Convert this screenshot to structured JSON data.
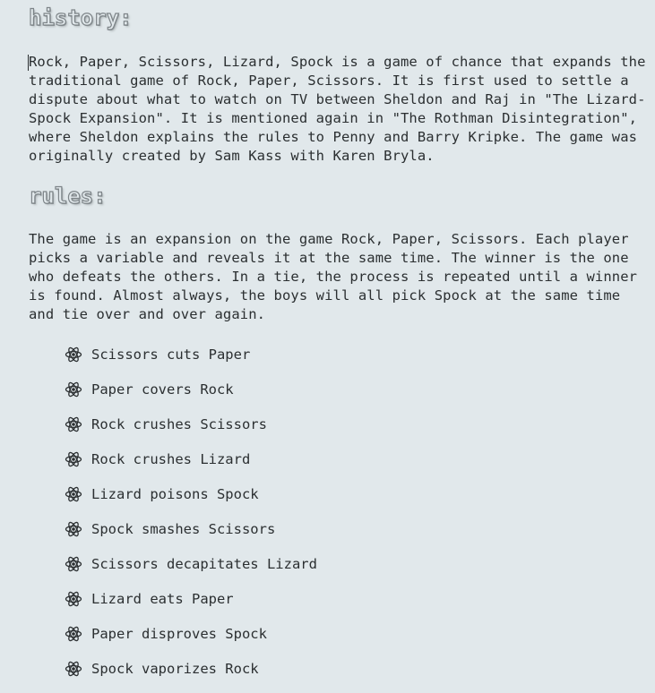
{
  "history": {
    "heading": "history:",
    "text": "Rock, Paper, Scissors, Lizard, Spock is a game of chance that expands the traditional game of Rock, Paper, Scissors. It is first used to settle a dispute about what to watch on TV between Sheldon and Raj in \"The Lizard-Spock Expansion\". It is mentioned again in \"The Rothman Disintegration\", where Sheldon explains the rules to Penny and Barry Kripke. The game was originally created by Sam Kass with Karen Bryla."
  },
  "rules": {
    "heading": "rules:",
    "text": "The game is an expansion on the game Rock, Paper, Scissors. Each player picks a variable and reveals it at the same time. The winner is the one who defeats the others. In a tie, the process is repeated until a winner is found. Almost always, the boys will all pick Spock at the same time and tie over and over again.",
    "bullet_icon": "atom-icon",
    "items": [
      "Scissors cuts Paper",
      "Paper covers Rock",
      "Rock crushes Scissors",
      "Rock crushes Lizard",
      "Lizard poisons Spock",
      "Spock smashes Scissors",
      "Scissors decapitates Lizard",
      "Lizard eats Paper",
      "Paper disproves Spock",
      "Spock vaporizes Rock"
    ]
  },
  "colors": {
    "background": "#e1e8eb",
    "text": "#2b2f31",
    "heading_outline": "#7e8589"
  }
}
